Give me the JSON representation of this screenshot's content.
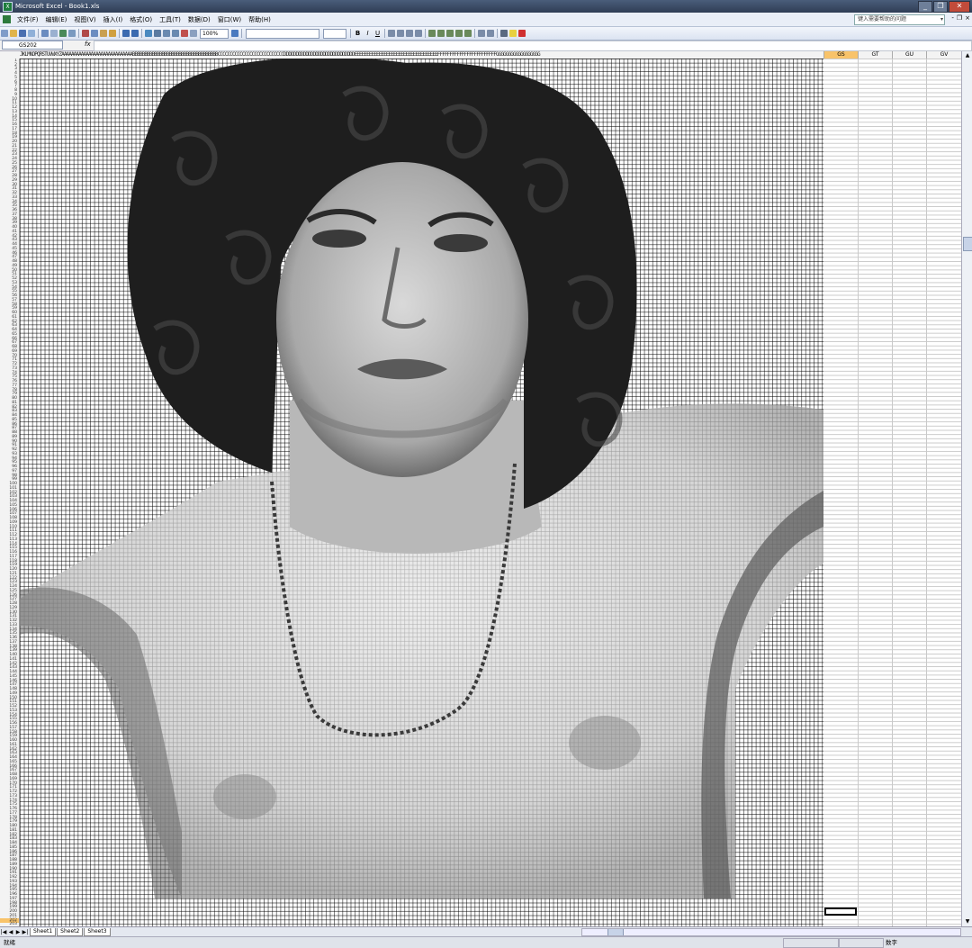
{
  "window": {
    "title": "Microsoft Excel - Book1.xls",
    "buttons": [
      "_",
      "❐",
      "✕"
    ]
  },
  "menu": {
    "items": [
      "文件(F)",
      "编辑(E)",
      "视图(V)",
      "插入(I)",
      "格式(O)",
      "工具(T)",
      "数据(D)",
      "窗口(W)",
      "帮助(H)"
    ],
    "help_placeholder": "键入需要帮助的问题",
    "doc_buttons": [
      "-",
      "❐",
      "×"
    ]
  },
  "toolbar": {
    "zoom": "100%",
    "bold": "B",
    "italic": "I",
    "underline": "U"
  },
  "formula_bar": {
    "name_box": "GS202",
    "fx": "fx",
    "value": ""
  },
  "sheet": {
    "packed_column_letters": "JKLMNOPQRSTUVWXYZAAAAAAAAAAAAAAAAAAAAAAAAAAAAABBBBBBBBBBBBBBBBBBBBBBBBBBBBBBBBBBBCCCCCCCCCCCCCCCCCCCCCCCCCCCDDDDDDDDDDDDDDDDDDDDDDDDDDDDDEEEEEEEEEEEEEEEEEEEEEEEEEEEEEEEEEEFFFFFFFFFFFFFFFFFFFFFFFFGGGGGGGGGGGGGGGGGG",
    "wide_columns": [
      "GS",
      "GT",
      "GU",
      "GV"
    ],
    "active_column": "GS",
    "active_row": "202",
    "rows": [
      "1",
      "2",
      "3",
      "4",
      "5",
      "6",
      "7",
      "8",
      "9",
      "10",
      "11",
      "12",
      "13",
      "14",
      "15",
      "16",
      "17",
      "18",
      "19",
      "20",
      "21",
      "22",
      "23",
      "24",
      "25",
      "26",
      "27",
      "28",
      "29",
      "30",
      "31",
      "32",
      "33",
      "34",
      "35",
      "36",
      "37",
      "38",
      "39",
      "40",
      "41",
      "42",
      "43",
      "44",
      "45",
      "46",
      "47",
      "48",
      "49",
      "50",
      "51",
      "52",
      "53",
      "54",
      "55",
      "56",
      "57",
      "58",
      "59",
      "60",
      "61",
      "62",
      "63",
      "64",
      "65",
      "66",
      "67",
      "68",
      "69",
      "70",
      "71",
      "72",
      "73",
      "74",
      "75",
      "76",
      "77",
      "78",
      "79",
      "80",
      "81",
      "82",
      "83",
      "84",
      "85",
      "86",
      "87",
      "88",
      "89",
      "90",
      "91",
      "92",
      "93",
      "94",
      "95",
      "96",
      "97",
      "98",
      "99",
      "100",
      "101",
      "102",
      "103",
      "104",
      "105",
      "106",
      "107",
      "108",
      "109",
      "110",
      "111",
      "112",
      "113",
      "114",
      "115",
      "116",
      "117",
      "118",
      "119",
      "120",
      "121",
      "122",
      "123",
      "124",
      "125",
      "126",
      "127",
      "128",
      "129",
      "130",
      "131",
      "132",
      "133",
      "134",
      "135",
      "136",
      "137",
      "138",
      "139",
      "140",
      "141",
      "142",
      "143",
      "144",
      "145",
      "146",
      "147",
      "148",
      "149",
      "150",
      "151",
      "152",
      "153",
      "154",
      "155",
      "156",
      "157",
      "158",
      "159",
      "160",
      "161",
      "162",
      "163",
      "164",
      "165",
      "166",
      "167",
      "168",
      "169",
      "170",
      "171",
      "172",
      "173",
      "174",
      "175",
      "176",
      "177",
      "178",
      "179",
      "180",
      "181",
      "182",
      "183",
      "184",
      "185",
      "186",
      "187",
      "188",
      "189",
      "190",
      "191",
      "192",
      "193",
      "194",
      "195",
      "196",
      "197",
      "198",
      "199",
      "200",
      "201",
      "202",
      "203"
    ]
  },
  "tabs": {
    "nav": [
      "|◀",
      "◀",
      "▶",
      "▶|"
    ],
    "sheets": [
      "Sheet1",
      "Sheet2",
      "Sheet3"
    ]
  },
  "status": {
    "left": "就绪",
    "right": "数字"
  },
  "colors": {
    "active_header": "#f8c36a",
    "title_bar": "#3a4a66",
    "grid_line": "#000000"
  }
}
